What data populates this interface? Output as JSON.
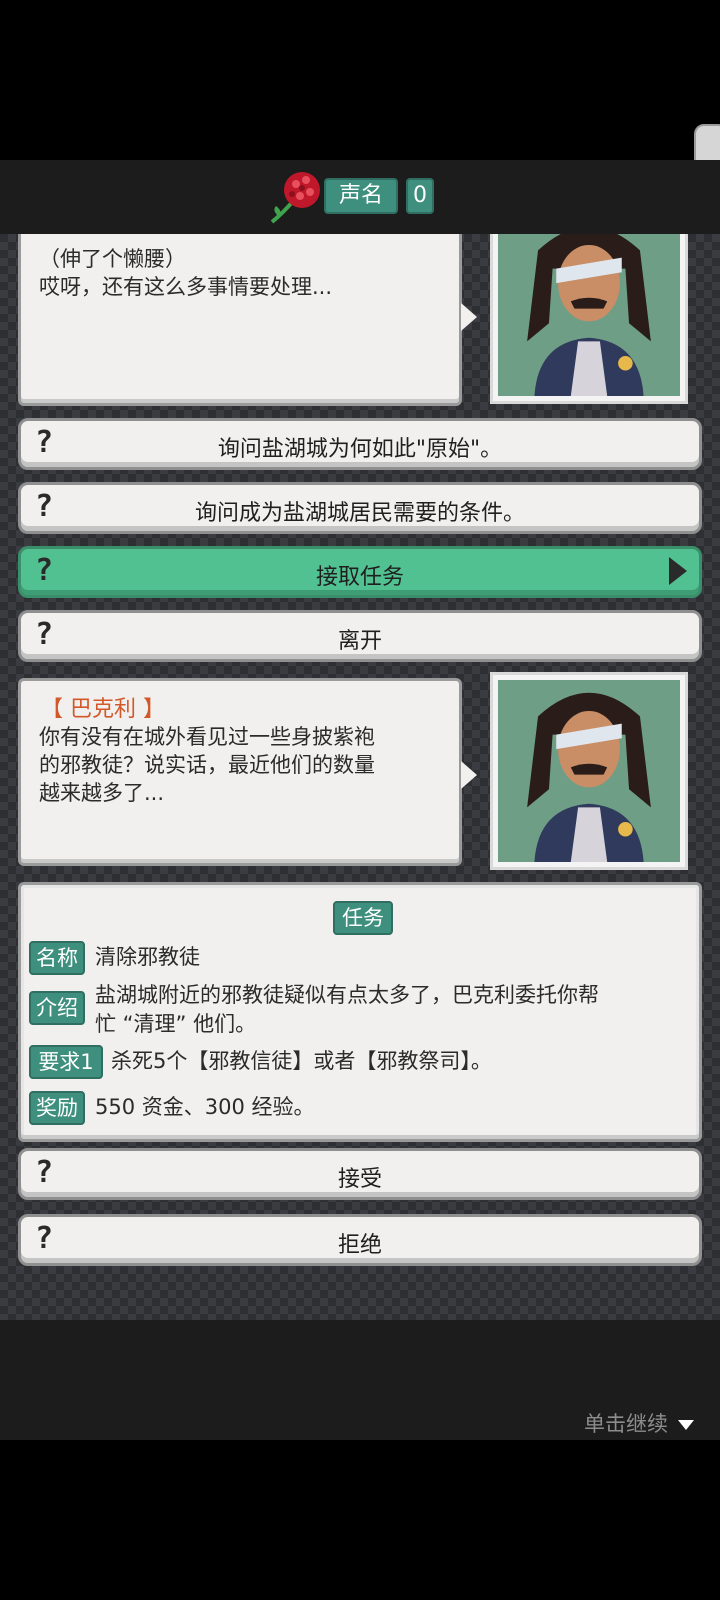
{
  "header": {
    "reputation_label": "声名",
    "reputation_value": "0",
    "icon": "rose-icon"
  },
  "dialog_top": {
    "line1": "（伸了个懒腰）",
    "line2": "哎呀，还有这么多事情要处理..."
  },
  "options_top": [
    {
      "label": "询问盐湖城为何如此\"原始\"。",
      "active": false
    },
    {
      "label": "询问成为盐湖城居民需要的条件。",
      "active": false
    },
    {
      "label": "接取任务",
      "active": true
    },
    {
      "label": "离开",
      "active": false
    }
  ],
  "option_marker": "?",
  "dialog_main": {
    "speaker": "【 巴克利 】",
    "line1": "你有没有在城外看见过一些身披紫袍",
    "line2": "的邪教徒？说实话，最近他们的数量",
    "line3": "越来越多了..."
  },
  "quest": {
    "title": "任务",
    "name_label": "名称",
    "name": "清除邪教徒",
    "intro_label": "介绍",
    "intro_line1": "盐湖城附近的邪教徒疑似有点太多了，巴克利委托你帮",
    "intro_line2": "忙 “清理” 他们。",
    "req_label": "要求1",
    "req": "杀死5个【邪教信徒】或者【邪教祭司】。",
    "reward_label": "奖励",
    "reward": "550 资金、300 经验。"
  },
  "options_bottom": [
    {
      "label": "接受"
    },
    {
      "label": "拒绝"
    }
  ],
  "footer": {
    "continue_label": "单击继续"
  },
  "colors": {
    "accent_green": "#52c192",
    "tag_green": "#3e8f7d",
    "speaker_orange": "#d2582a"
  }
}
